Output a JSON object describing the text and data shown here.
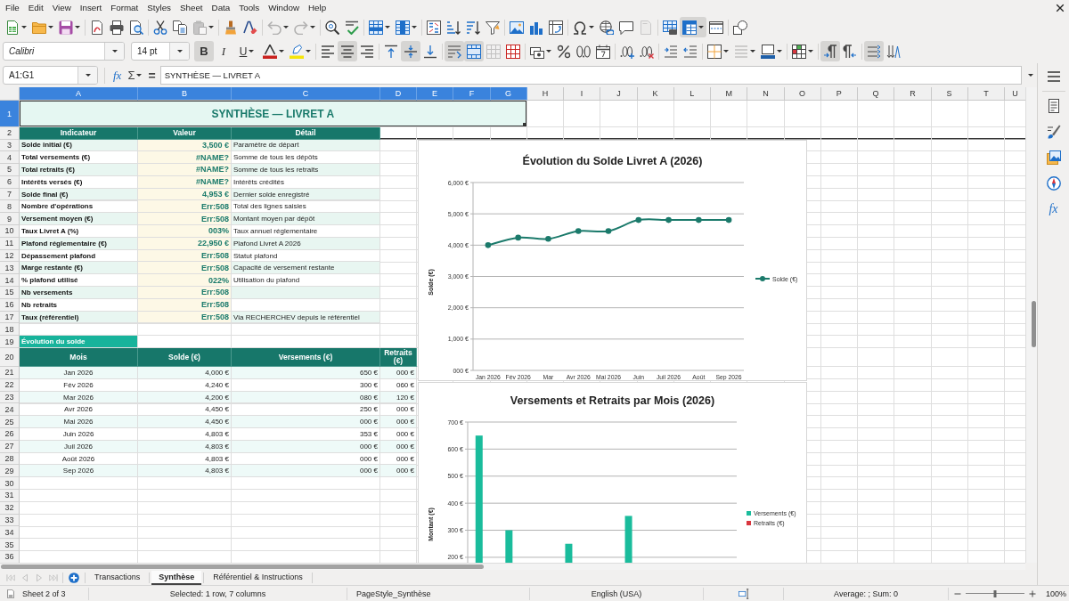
{
  "menu": [
    "File",
    "Edit",
    "View",
    "Insert",
    "Format",
    "Styles",
    "Sheet",
    "Data",
    "Tools",
    "Window",
    "Help"
  ],
  "standard_toolbar": {
    "paste": {
      "disabled": true
    },
    "undo": {
      "disabled": true
    },
    "redo": {
      "disabled": true
    },
    "header_footer": {
      "disabled": true
    },
    "freeze_rows_and_columns": {
      "on": true
    }
  },
  "formatting_toolbar": {
    "font_name": "Calibri",
    "font_size": "14 pt",
    "bold": {
      "label": "B",
      "on": true
    },
    "italic": {
      "label": "I",
      "on": false
    },
    "underline": {
      "label": "U",
      "on": false
    },
    "align_left": {
      "on": false
    },
    "align_center": {
      "on": true
    },
    "align_right": {
      "on": false
    },
    "align_top": {
      "on": false
    },
    "align_center_vertically": {
      "on": true
    },
    "align_bottom": {
      "on": false
    },
    "wrap_text": {
      "on": true
    },
    "merge_and_center": {
      "on": true
    },
    "unmerge": {
      "disabled": true
    },
    "border_style": {
      "disabled": true
    },
    "left_to_right": {
      "on": true
    },
    "right_to_left": {
      "on": false
    },
    "text_left_to_right": {
      "on": true
    },
    "text_top_to_bottom": {
      "on": false
    }
  },
  "formula_bar": {
    "name_box": "A1:G1",
    "function_wizard": "fx",
    "sum": "Σ",
    "equals": "=",
    "formula": "SYNTHÈSE — LIVRET A"
  },
  "sidebar": {
    "functions": "fx"
  },
  "sheet": {
    "columns": [
      {
        "label": "A",
        "selected": true
      },
      {
        "label": "B",
        "selected": true
      },
      {
        "label": "C",
        "selected": true
      },
      {
        "label": "D",
        "selected": true
      },
      {
        "label": "E",
        "selected": true
      },
      {
        "label": "F",
        "selected": true
      },
      {
        "label": "G",
        "selected": true
      },
      {
        "label": "H",
        "selected": false
      },
      {
        "label": "I",
        "selected": false
      },
      {
        "label": "J",
        "selected": false
      },
      {
        "label": "K",
        "selected": false
      },
      {
        "label": "L",
        "selected": false
      },
      {
        "label": "M",
        "selected": false
      },
      {
        "label": "N",
        "selected": false
      },
      {
        "label": "O",
        "selected": false
      },
      {
        "label": "P",
        "selected": false
      },
      {
        "label": "Q",
        "selected": false
      },
      {
        "label": "R",
        "selected": false
      },
      {
        "label": "S",
        "selected": false
      },
      {
        "label": "T",
        "selected": false
      },
      {
        "label": "U",
        "selected": false
      }
    ],
    "rows": [
      {
        "label": "1",
        "selected": true
      },
      {
        "label": "2",
        "selected": false
      },
      {
        "label": "3",
        "selected": false
      },
      {
        "label": "4",
        "selected": false
      },
      {
        "label": "5",
        "selected": false
      },
      {
        "label": "6",
        "selected": false
      },
      {
        "label": "7",
        "selected": false
      },
      {
        "label": "8",
        "selected": false
      },
      {
        "label": "9",
        "selected": false
      },
      {
        "label": "10",
        "selected": false
      },
      {
        "label": "11",
        "selected": false
      },
      {
        "label": "12",
        "selected": false
      },
      {
        "label": "13",
        "selected": false
      },
      {
        "label": "14",
        "selected": false
      },
      {
        "label": "15",
        "selected": false
      },
      {
        "label": "16",
        "selected": false
      },
      {
        "label": "17",
        "selected": false
      },
      {
        "label": "18",
        "selected": false
      },
      {
        "label": "19",
        "selected": false
      },
      {
        "label": "20",
        "selected": false
      },
      {
        "label": "21",
        "selected": false
      },
      {
        "label": "22",
        "selected": false
      },
      {
        "label": "23",
        "selected": false
      },
      {
        "label": "24",
        "selected": false
      },
      {
        "label": "25",
        "selected": false
      },
      {
        "label": "26",
        "selected": false
      },
      {
        "label": "27",
        "selected": false
      },
      {
        "label": "28",
        "selected": false
      },
      {
        "label": "29",
        "selected": false
      },
      {
        "label": "30",
        "selected": false
      },
      {
        "label": "31",
        "selected": false
      },
      {
        "label": "32",
        "selected": false
      },
      {
        "label": "33",
        "selected": false
      },
      {
        "label": "34",
        "selected": false
      },
      {
        "label": "35",
        "selected": false
      },
      {
        "label": "36",
        "selected": false
      }
    ],
    "title": {
      "text": "SYNTHÈSE — LIVRET A",
      "selected": true
    },
    "summary_table": {
      "columns": [
        "Indicateur",
        "Valeur",
        "Détail"
      ],
      "rows": [
        {
          "indicateur": "Solde initial (€)",
          "valeur": "3,500 €",
          "detail": "Paramètre de départ"
        },
        {
          "indicateur": "Total versements (€)",
          "valeur": "#NAME?",
          "detail": "Somme de tous les dépôts"
        },
        {
          "indicateur": "Total retraits (€)",
          "valeur": "#NAME?",
          "detail": "Somme de tous les retraits"
        },
        {
          "indicateur": "Intérêts versés (€)",
          "valeur": "#NAME?",
          "detail": "Intérêts crédités"
        },
        {
          "indicateur": "Solde final (€)",
          "valeur": "4,953 €",
          "detail": "Dernier solde enregistré"
        },
        {
          "indicateur": "Nombre d'opérations",
          "valeur": "Err:508",
          "detail": "Total des lignes saisies"
        },
        {
          "indicateur": "Versement moyen (€)",
          "valeur": "Err:508",
          "detail": "Montant moyen par dépôt"
        },
        {
          "indicateur": "Taux Livret A (%)",
          "valeur": "003%",
          "detail": "Taux annuel réglementaire"
        },
        {
          "indicateur": "Plafond réglementaire (€)",
          "valeur": "22,950 €",
          "detail": "Plafond Livret A 2026"
        },
        {
          "indicateur": "Dépassement plafond",
          "valeur": "Err:508",
          "detail": "Statut plafond"
        },
        {
          "indicateur": "Marge restante (€)",
          "valeur": "Err:508",
          "detail": "Capacité de versement restante"
        },
        {
          "indicateur": "% plafond utilisé",
          "valeur": "022%",
          "detail": "Utilisation du plafond"
        },
        {
          "indicateur": "Nb versements",
          "valeur": "Err:508"
        },
        {
          "indicateur": "Nb retraits",
          "valeur": "Err:508"
        },
        {
          "indicateur": "Taux (référentiel)",
          "valeur": "Err:508",
          "detail": "Via RECHERCHEV depuis le référentiel"
        }
      ]
    },
    "section_label": "Évolution du solde",
    "monthly_table": {
      "columns": [
        "Mois",
        "Solde (€)",
        "Versements (€)",
        "Retraits (€)"
      ],
      "rows": [
        {
          "mois": "Jan 2026",
          "solde": "4,000 €",
          "versements": "650 €",
          "retraits": "000 €"
        },
        {
          "mois": "Fév 2026",
          "solde": "4,240 €",
          "versements": "300 €",
          "retraits": "060 €"
        },
        {
          "mois": "Mar 2026",
          "solde": "4,200 €",
          "versements": "080 €",
          "retraits": "120 €"
        },
        {
          "mois": "Avr 2026",
          "solde": "4,450 €",
          "versements": "250 €",
          "retraits": "000 €"
        },
        {
          "mois": "Mai 2026",
          "solde": "4,450 €",
          "versements": "000 €",
          "retraits": "000 €"
        },
        {
          "mois": "Juin 2026",
          "solde": "4,803 €",
          "versements": "353 €",
          "retraits": "000 €"
        },
        {
          "mois": "Juil 2026",
          "solde": "4,803 €",
          "versements": "000 €",
          "retraits": "000 €"
        },
        {
          "mois": "Août 2026",
          "solde": "4,803 €",
          "versements": "000 €",
          "retraits": "000 €"
        },
        {
          "mois": "Sep 2026",
          "solde": "4,803 €",
          "versements": "000 €",
          "retraits": "000 €"
        }
      ]
    }
  },
  "charts": [
    {
      "chart_data": {
        "type": "line",
        "title": "Évolution du Solde Livret A (2026)",
        "ylabel": "Solde (€)",
        "categories": [
          "Jan 2026",
          "Fév 2026",
          "Mar",
          "Avr 2026",
          "Mai 2026",
          "Juin",
          "Juil 2026",
          "Août",
          "Sep 2026"
        ],
        "series": [
          {
            "name": "Solde (€)",
            "color": "#1b7a6b",
            "marker": "circle",
            "values": [
              4000,
              4240,
              4200,
              4450,
              4450,
              4803,
              4803,
              4803,
              4803
            ]
          }
        ],
        "ylim": [
          0,
          6000
        ],
        "yticks": [
          {
            "value": 0,
            "label": "000 €"
          },
          {
            "value": 1000,
            "label": "1,000 €"
          },
          {
            "value": 2000,
            "label": "2,000 €"
          },
          {
            "value": 3000,
            "label": "3,000 €"
          },
          {
            "value": 4000,
            "label": "4,000 €"
          },
          {
            "value": 5000,
            "label": "5,000 €"
          },
          {
            "value": 6000,
            "label": "6,000 €"
          }
        ],
        "grid": true
      }
    },
    {
      "chart_data": {
        "type": "bar",
        "title": "Versements et Retraits par Mois (2026)",
        "ylabel": "Montant (€)",
        "series": [
          {
            "name": "Versements (€)",
            "color": "#1abc9c",
            "values": [
              650,
              300,
              null,
              250,
              null,
              353,
              null,
              null,
              null
            ]
          },
          {
            "name": "Retraits (€)",
            "color": "#d9363e",
            "values": [
              null,
              null,
              null,
              null,
              null,
              null,
              null,
              null,
              null
            ]
          }
        ],
        "ylim": [
          180,
          700
        ],
        "yticks": [
          {
            "value": 200,
            "label": "200 €"
          },
          {
            "value": 300,
            "label": "300 €"
          },
          {
            "value": 400,
            "label": "400 €"
          },
          {
            "value": 500,
            "label": "500 €"
          },
          {
            "value": 600,
            "label": "600 €"
          },
          {
            "value": 700,
            "label": "700 €"
          }
        ],
        "grid": true
      }
    }
  ],
  "sheet_navigation": {
    "disabled": true
  },
  "sheet_tabs": [
    {
      "label": "Transactions",
      "selected": false
    },
    {
      "label": "Synthèse",
      "selected": true
    },
    {
      "label": "Référentiel & Instructions",
      "selected": false
    }
  ],
  "status_bar": {
    "sheet": "Sheet 2 of 3",
    "selection": "Selected: 1 row, 7 columns",
    "page_style": "PageStyle_Synthèse",
    "language": "English (USA)",
    "summary": "Average: ; Sum: 0",
    "zoom": {
      "level": 0.5,
      "reading": "100%"
    }
  }
}
